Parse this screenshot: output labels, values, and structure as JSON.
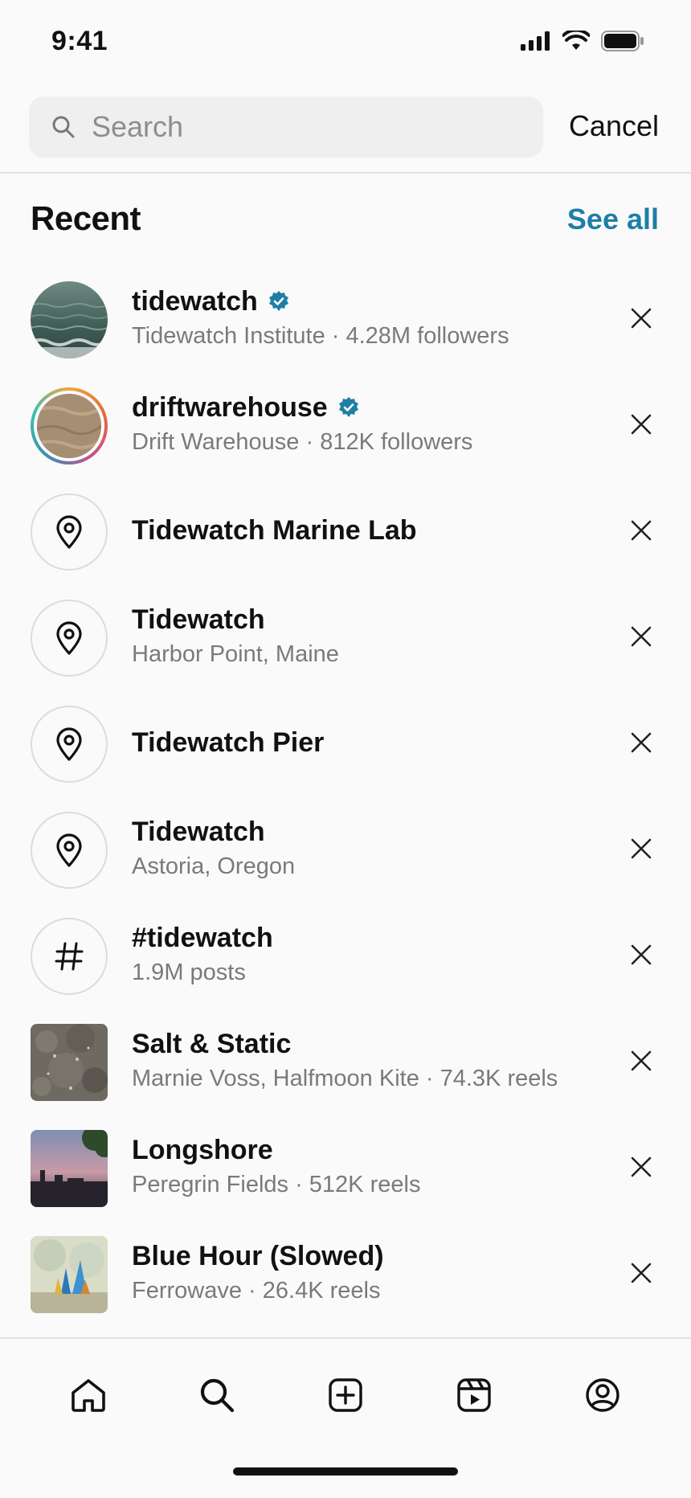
{
  "status_bar": {
    "time": "9:41"
  },
  "search": {
    "placeholder": "Search",
    "value": "",
    "cancel_label": "Cancel"
  },
  "recent": {
    "title": "Recent",
    "see_all_label": "See all",
    "items": [
      {
        "kind": "account",
        "title": "tidewatch",
        "verified": true,
        "subtitle": "Tidewatch Institute · 4.28M followers"
      },
      {
        "kind": "account",
        "title": "driftwarehouse",
        "verified": true,
        "subtitle": "Drift Warehouse · 812K followers"
      },
      {
        "kind": "place",
        "title": "Tidewatch Marine Lab",
        "subtitle": ""
      },
      {
        "kind": "place",
        "title": "Tidewatch",
        "subtitle": "Harbor Point, Maine"
      },
      {
        "kind": "place",
        "title": "Tidewatch Pier",
        "subtitle": ""
      },
      {
        "kind": "place",
        "title": "Tidewatch",
        "subtitle": "Astoria, Oregon"
      },
      {
        "kind": "hashtag",
        "title": "#tidewatch",
        "subtitle": "1.9M posts"
      },
      {
        "kind": "audio",
        "title": "Salt & Static",
        "subtitle": "Marnie Voss, Halfmoon Kite · 74.3K reels"
      },
      {
        "kind": "audio",
        "title": "Longshore",
        "subtitle": "Peregrin Fields · 512K reels"
      },
      {
        "kind": "audio",
        "title": "Blue Hour (Slowed)",
        "subtitle": "Ferrowave · 26.4K reels"
      }
    ]
  },
  "tab_bar": {
    "active": "search",
    "tabs": [
      "home",
      "search",
      "create",
      "reels",
      "profile"
    ]
  },
  "colors": {
    "accent": "#1d7fa6",
    "verified": "#1d7fa6"
  }
}
